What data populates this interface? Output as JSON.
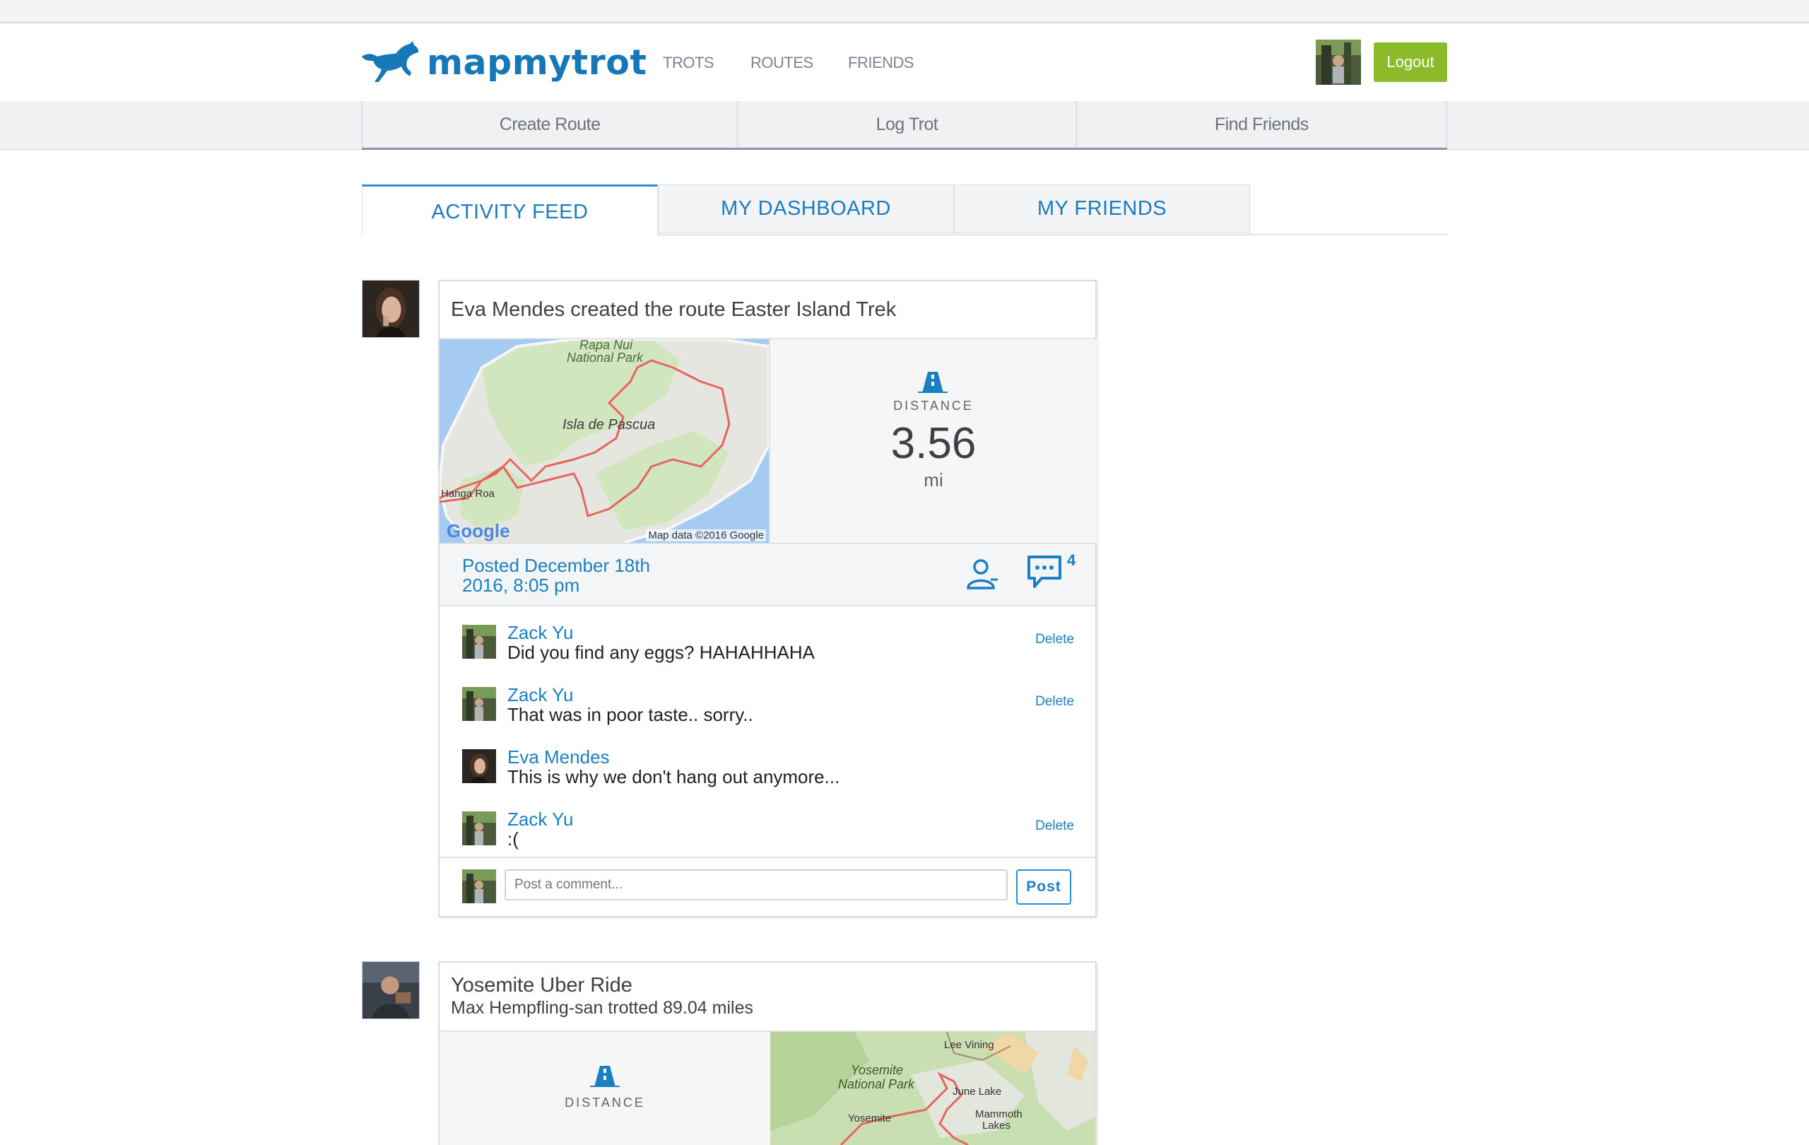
{
  "brand": {
    "name": "mapmytrot"
  },
  "nav": {
    "trots": "TROTS",
    "routes": "ROUTES",
    "friends": "FRIENDS",
    "logout": "Logout"
  },
  "subnav": {
    "create_route": "Create Route",
    "log_trot": "Log Trot",
    "find_friends": "Find Friends"
  },
  "tabs": {
    "activity_feed": "ACTIVITY FEED",
    "my_dashboard": "MY DASHBOARD",
    "my_friends": "MY FRIENDS",
    "active": "activity_feed"
  },
  "feed": {
    "item1": {
      "title": "Eva Mendes created the route Easter Island Trek",
      "map": {
        "label_park_1": "Rapa Nui",
        "label_park_2": "National Park",
        "label_island": "Isla de Pascua",
        "label_town": "Hanga Roa",
        "google": "Google",
        "attribution": "Map data ©2016 Google"
      },
      "stat": {
        "label": "DISTANCE",
        "value": "3.56",
        "unit": "mi"
      },
      "posted_line1": "Posted December 18th",
      "posted_line2": "2016, 8:05 pm",
      "comment_count": "4",
      "comments": [
        {
          "name": "Zack Yu",
          "text": "Did you find any eggs? HAHAHHAHA",
          "delete": "Delete"
        },
        {
          "name": "Zack Yu",
          "text": "That was in poor taste.. sorry..",
          "delete": "Delete"
        },
        {
          "name": "Eva Mendes",
          "text": "This is why we don't hang out anymore..."
        },
        {
          "name": "Zack Yu",
          "text": ":(",
          "delete": "Delete"
        }
      ],
      "comment_placeholder": "Post a comment...",
      "post_label": "Post"
    },
    "item2": {
      "title": "Yosemite Uber Ride",
      "subtitle": "Max Hempfling-san trotted 89.04 miles",
      "stat": {
        "label": "DISTANCE"
      },
      "map": {
        "lee_vining": "Lee Vining",
        "park_1": "Yosemite",
        "park_2": "National Park",
        "june_lake": "June Lake",
        "mammoth_1": "Mammoth",
        "mammoth_2": "Lakes",
        "yosemite": "Yosemite"
      }
    }
  },
  "colors": {
    "brand_blue": "#1778b8",
    "logout_green": "#8cba2b",
    "route_red": "#e8645f"
  }
}
